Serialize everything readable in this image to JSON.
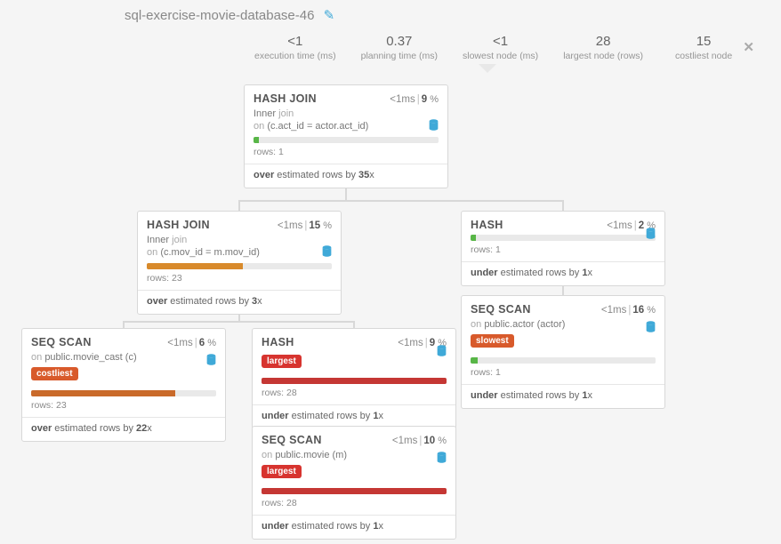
{
  "title": "sql-exercise-movie-database-46",
  "edit_icon_glyph": "✎",
  "close_glyph": "✕",
  "stats": [
    {
      "value": "<1",
      "label": "execution time (ms)"
    },
    {
      "value": "0.37",
      "label": "planning time (ms)"
    },
    {
      "value": "<1",
      "label": "slowest node (ms)"
    },
    {
      "value": "28",
      "label": "largest node (rows)"
    },
    {
      "value": "15",
      "label": "costliest node"
    }
  ],
  "nodes": {
    "n0": {
      "name": "HASH JOIN",
      "time": "<1ms",
      "pct": "9",
      "sub1_a": "Inner",
      "sub1_b": "join",
      "sub2_pre": "on",
      "sub2_val": "(c.act_id = actor.act_id)",
      "rows": "rows: 1",
      "est_dir": "over",
      "est_mid": " estimated rows by ",
      "est_by": "35",
      "est_suf": "x",
      "bar_pct": 3,
      "bar_class": "fill-green"
    },
    "n1": {
      "name": "HASH JOIN",
      "time": "<1ms",
      "pct": "15",
      "sub1_a": "Inner",
      "sub1_b": "join",
      "sub2_pre": "on",
      "sub2_val": "(c.mov_id = m.mov_id)",
      "rows": "rows: 23",
      "est_dir": "over",
      "est_mid": " estimated rows by ",
      "est_by": "3",
      "est_suf": "x",
      "bar_pct": 52,
      "bar_class": "fill-orange"
    },
    "n2": {
      "name": "HASH",
      "time": "<1ms",
      "pct": "2",
      "rows": "rows: 1",
      "est_dir": "under",
      "est_mid": " estimated rows by ",
      "est_by": "1",
      "est_suf": "x",
      "bar_pct": 3,
      "bar_class": "fill-green"
    },
    "n3": {
      "name": "SEQ SCAN",
      "time": "<1ms",
      "pct": "6",
      "sub2_pre": "on",
      "sub2_val": "public.movie_cast (c)",
      "badge": "costliest",
      "badge_class": "redorange",
      "rows": "rows: 23",
      "est_dir": "over",
      "est_mid": " estimated rows by ",
      "est_by": "22",
      "est_suf": "x",
      "bar_pct": 78,
      "bar_class": "fill-dorange"
    },
    "n4": {
      "name": "HASH",
      "time": "<1ms",
      "pct": "9",
      "badge": "largest",
      "badge_class": "red",
      "rows": "rows: 28",
      "est_dir": "under",
      "est_mid": " estimated rows by ",
      "est_by": "1",
      "est_suf": "x",
      "bar_pct": 100,
      "bar_class": "fill-red"
    },
    "n5": {
      "name": "SEQ SCAN",
      "time": "<1ms",
      "pct": "16",
      "sub2_pre": "on",
      "sub2_val": "public.actor (actor)",
      "badge": "slowest",
      "badge_class": "redorange",
      "rows": "rows: 1",
      "est_dir": "under",
      "est_mid": " estimated rows by ",
      "est_by": "1",
      "est_suf": "x",
      "bar_pct": 4,
      "bar_class": "fill-green"
    },
    "n6": {
      "name": "SEQ SCAN",
      "time": "<1ms",
      "pct": "10",
      "sub2_pre": "on",
      "sub2_val": "public.movie (m)",
      "badge": "largest",
      "badge_class": "red",
      "rows": "rows: 28",
      "est_dir": "under",
      "est_mid": " estimated rows by ",
      "est_by": "1",
      "est_suf": "x",
      "bar_pct": 100,
      "bar_class": "fill-red"
    }
  }
}
